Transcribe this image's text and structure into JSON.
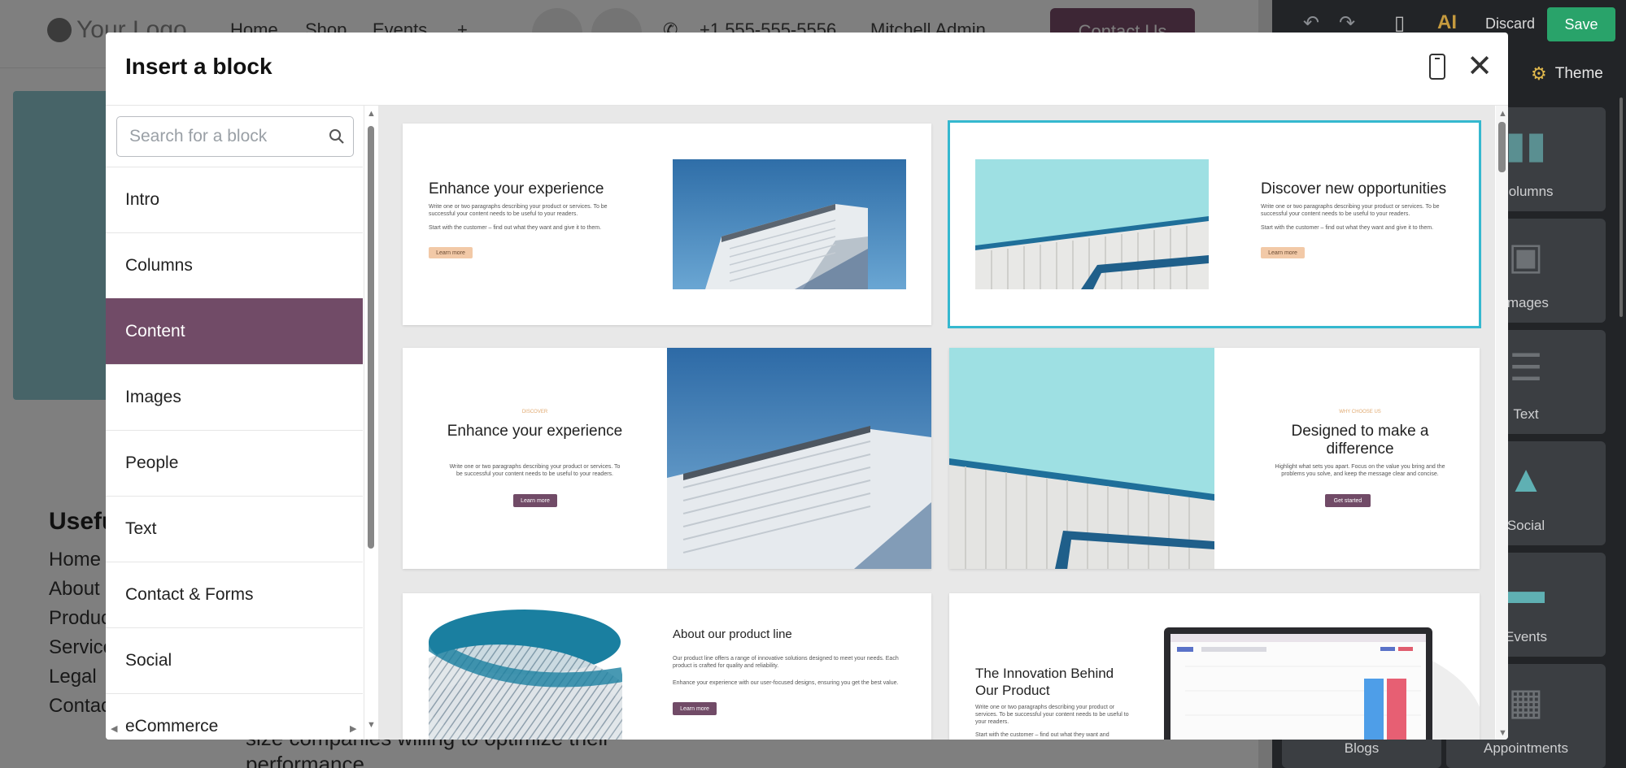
{
  "site": {
    "logo_text": "Your Logo",
    "nav": [
      "Home",
      "Shop",
      "Events",
      "+"
    ],
    "phone": "+1 555-555-5556",
    "user": "Mitchell Admin",
    "contact_button": "Contact Us",
    "footer": {
      "title": "Useful Links",
      "links": [
        "Home",
        "About us",
        "Products",
        "Services",
        "Legal",
        "Contact us"
      ],
      "paragraph": "size companies willing to optimize their performance"
    }
  },
  "editor": {
    "undo_icon": "undo-icon",
    "redo_icon": "redo-icon",
    "discard_label": "Discard",
    "save_label": "Save",
    "theme_label": "Theme",
    "tiles": [
      {
        "label": "Columns",
        "icon": "columns-icon"
      },
      {
        "label": "Images",
        "icon": "images-icon"
      },
      {
        "label": "Text",
        "icon": "text-icon"
      },
      {
        "label": "Social",
        "icon": "social-icon"
      },
      {
        "label": "Events",
        "icon": "events-icon"
      },
      {
        "label": "Blogs",
        "icon": "blogs-icon"
      },
      {
        "label": "Appointments",
        "icon": "appointments-icon"
      }
    ]
  },
  "modal": {
    "title": "Insert a block",
    "search_placeholder": "Search for a block",
    "categories": [
      "Intro",
      "Columns",
      "Content",
      "Images",
      "People",
      "Text",
      "Contact & Forms",
      "Social",
      "eCommerce"
    ],
    "active_category": "Content",
    "previews": [
      {
        "title": "Enhance your experience",
        "text1": "Write one or two paragraphs describing your product or services. To be successful your content needs to be useful to your readers.",
        "text2": "Start with the customer – find out what they want and give it to them.",
        "button": "Learn more"
      },
      {
        "title": "Discover new opportunities",
        "text1": "Write one or two paragraphs describing your product or services. To be successful your content needs to be useful to your readers.",
        "text2": "Start with the customer – find out what they want and give it to them.",
        "button": "Learn more"
      },
      {
        "eyebrow": "DISCOVER",
        "title": "Enhance your experience",
        "text1": "Write one or two paragraphs describing your product or services. To be successful your content needs to be useful to your readers.",
        "button": "Learn more"
      },
      {
        "eyebrow": "WHY CHOOSE US",
        "title": "Designed to make a difference",
        "text1": "Highlight what sets you apart. Focus on the value you bring and the problems you solve, and keep the message clear and concise.",
        "button": "Get started"
      },
      {
        "title": "About our product line",
        "text1": "Our product line offers a range of innovative solutions designed to meet your needs. Each product is crafted for quality and reliability.",
        "text2": "Enhance your experience with our user-focused designs, ensuring you get the best value.",
        "button": "Learn more"
      },
      {
        "title": "The Innovation Behind Our Product",
        "text1": "Write one or two paragraphs describing your product or services. To be successful your content needs to be useful to your readers.",
        "text2": "Start with the customer – find out what they want and"
      }
    ]
  },
  "colors": {
    "accent": "#714b67",
    "selection": "#35b8cf",
    "save": "#29a36a",
    "peach_button": "#f2c9a7"
  }
}
